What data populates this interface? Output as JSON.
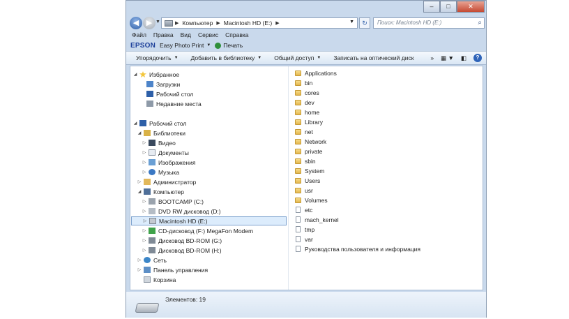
{
  "window": {
    "controls": {
      "minimize": "–",
      "maximize": "□",
      "close": "✕"
    }
  },
  "address": {
    "back_icon": "back-arrow-icon",
    "forward_icon": "forward-arrow-icon",
    "crumbs": [
      "Компьютер",
      "Macintosh HD (E:)"
    ],
    "search_placeholder": "Поиск: Macintosh HD (E:)"
  },
  "menu": [
    "Файл",
    "Правка",
    "Вид",
    "Сервис",
    "Справка"
  ],
  "epson_bar": {
    "brand": "EPSON",
    "app": "Easy Photo Print",
    "print": "Печать"
  },
  "toolbar": {
    "organize": "Упорядочить",
    "add_library": "Добавить в библиотеку",
    "share": "Общий доступ",
    "burn": "Записать на оптический диск",
    "more": "»"
  },
  "nav": [
    {
      "label": "Избранное",
      "icon": "star-icon"
    },
    {
      "label": "Загрузки",
      "icon": "downloads-icon"
    },
    {
      "label": "Рабочий стол",
      "icon": "desktop-icon"
    },
    {
      "label": "Недавние места",
      "icon": "recent-places-icon"
    },
    {
      "label": "Рабочий стол",
      "icon": "desktop-icon"
    },
    {
      "label": "Библиотеки",
      "icon": "libraries-icon"
    },
    {
      "label": "Видео",
      "icon": "video-icon"
    },
    {
      "label": "Документы",
      "icon": "documents-icon"
    },
    {
      "label": "Изображения",
      "icon": "images-icon"
    },
    {
      "label": "Музыка",
      "icon": "music-icon"
    },
    {
      "label": "Администратор",
      "icon": "user-folder-icon"
    },
    {
      "label": "Компьютер",
      "icon": "computer-icon"
    },
    {
      "label": "BOOTCAMP (C:)",
      "icon": "drive-icon"
    },
    {
      "label": "DVD RW дисковод (D:)",
      "icon": "dvd-drive-icon"
    },
    {
      "label": "Macintosh HD (E:)",
      "icon": "drive-icon"
    },
    {
      "label": "CD-дисковод (F:) MegaFon Modem",
      "icon": "cd-drive-icon"
    },
    {
      "label": "Дисковод BD-ROM (G:)",
      "icon": "bd-drive-icon"
    },
    {
      "label": "Дисковод BD-ROM (H:)",
      "icon": "bd-drive-icon"
    },
    {
      "label": "Сеть",
      "icon": "network-icon"
    },
    {
      "label": "Панель управления",
      "icon": "control-panel-icon"
    },
    {
      "label": "Корзина",
      "icon": "recycle-bin-icon"
    }
  ],
  "files": [
    {
      "name": "Applications",
      "type": "folder"
    },
    {
      "name": "bin",
      "type": "folder"
    },
    {
      "name": "cores",
      "type": "folder"
    },
    {
      "name": "dev",
      "type": "folder"
    },
    {
      "name": "home",
      "type": "folder"
    },
    {
      "name": "Library",
      "type": "folder"
    },
    {
      "name": "net",
      "type": "folder"
    },
    {
      "name": "Network",
      "type": "folder"
    },
    {
      "name": "private",
      "type": "folder"
    },
    {
      "name": "sbin",
      "type": "folder"
    },
    {
      "name": "System",
      "type": "folder"
    },
    {
      "name": "Users",
      "type": "folder"
    },
    {
      "name": "usr",
      "type": "folder"
    },
    {
      "name": "Volumes",
      "type": "folder"
    },
    {
      "name": "etc",
      "type": "file"
    },
    {
      "name": "mach_kernel",
      "type": "file"
    },
    {
      "name": "tmp",
      "type": "file"
    },
    {
      "name": "var",
      "type": "file"
    },
    {
      "name": "Руководства пользователя и информация",
      "type": "file"
    }
  ],
  "status": {
    "count": "Элементов: 19"
  }
}
